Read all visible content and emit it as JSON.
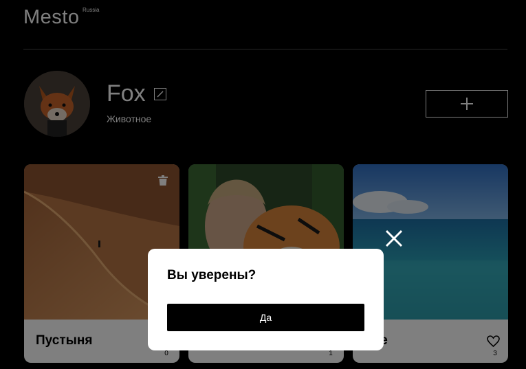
{
  "header": {
    "logo": "Mesto",
    "logo_sub": "Russia"
  },
  "profile": {
    "name": "Fox",
    "about": "Животное",
    "avatar_icon": "fox-avatar"
  },
  "cards": [
    {
      "title": "Пустыня",
      "likes": "0",
      "deletable": true
    },
    {
      "title": "",
      "likes": "1",
      "deletable": false
    },
    {
      "title": "оре",
      "likes": "3",
      "deletable": false
    }
  ],
  "popup": {
    "title": "Вы уверены?",
    "submit_label": "Да"
  },
  "colors": {
    "background": "#000000",
    "card": "#ffffff",
    "overlay": "rgba(0,0,0,0.5)",
    "divider": "#545454"
  }
}
